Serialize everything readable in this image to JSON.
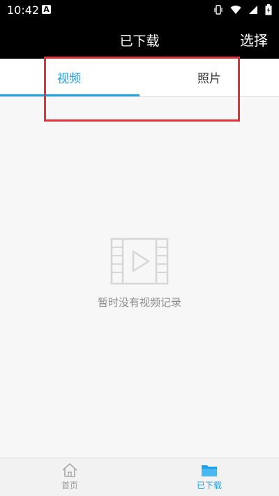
{
  "status": {
    "time": "10:42",
    "app_icon_letter": "A"
  },
  "header": {
    "title": "已下载",
    "action": "选择"
  },
  "tabs": [
    {
      "label": "视频",
      "active": true
    },
    {
      "label": "照片",
      "active": false
    }
  ],
  "empty_state": {
    "message": "暂时没有视频记录",
    "icon": "video-film-icon"
  },
  "bottom_nav": [
    {
      "label": "首页",
      "icon": "home-icon",
      "active": false
    },
    {
      "label": "已下载",
      "icon": "folder-icon",
      "active": true
    }
  ],
  "colors": {
    "accent": "#1fa3e6",
    "highlight": "#e0323a",
    "header_bg": "#000000"
  }
}
